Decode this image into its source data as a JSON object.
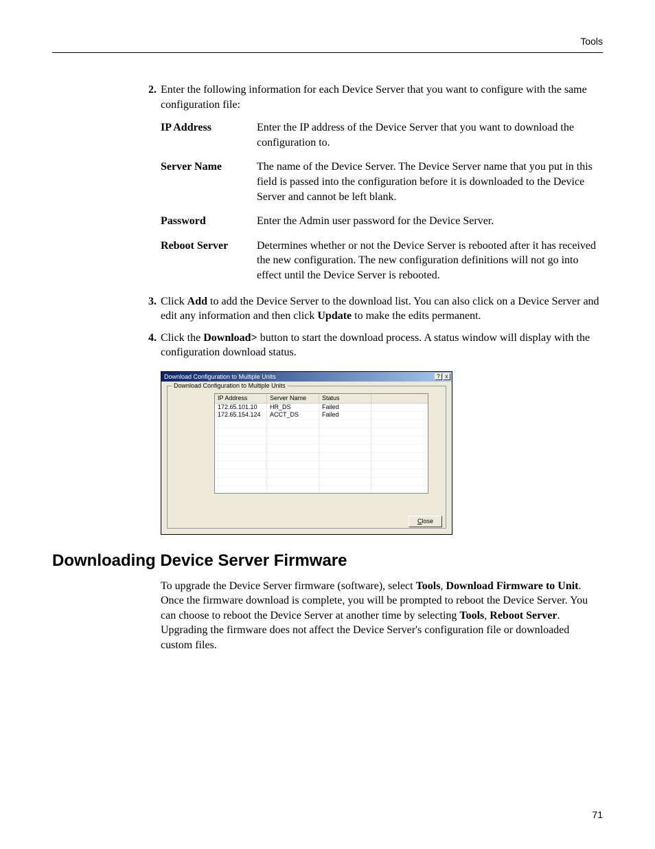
{
  "header": {
    "section": "Tools"
  },
  "pageNumber": "71",
  "list": {
    "item2": {
      "num": "2.",
      "text": "Enter the following information for each Device Server that you want to configure with the same configuration file:"
    },
    "item3": {
      "num": "3.",
      "before": "Click ",
      "b1": "Add",
      "mid": " to add the Device Server to the download list. You can also click on a Device Server and edit any information and then click ",
      "b2": "Update",
      "after": " to make the edits permanent."
    },
    "item4": {
      "num": "4.",
      "before": "Click the ",
      "b1": "Download>",
      "after": " button to start the download process. A status window will display with the configuration download status."
    }
  },
  "defs": [
    {
      "term": "IP Address",
      "desc": "Enter the IP address of the Device Server that you want to download the configuration to."
    },
    {
      "term": "Server Name",
      "desc": "The name of the Device Server. The Device Server name that you put in this field is passed into the configuration before it is downloaded to the Device Server and cannot be left blank."
    },
    {
      "term": "Password",
      "desc": "Enter the Admin user password for the Device Server."
    },
    {
      "term": "Reboot Server",
      "desc": "Determines whether or not the Device Server is rebooted after it has received the new configuration. The new configuration definitions will not go into effect until the Device Server is rebooted."
    }
  ],
  "dialog": {
    "title": "Download Configuration to Multiple Units",
    "group": "Download Configuration to Multiple Units",
    "columns": [
      "IP Address",
      "Server Name",
      "Status",
      ""
    ],
    "rows": [
      {
        "ip": "172.65.101.10",
        "name": "HR_DS",
        "status": "Failed"
      },
      {
        "ip": "172.65.154.124",
        "name": "ACCT_DS",
        "status": "Failed"
      }
    ],
    "closeU": "C",
    "closeRest": "lose",
    "help": "?",
    "x": "x"
  },
  "heading": "Downloading Device Server Firmware",
  "firmwarePara": {
    "t1": "To upgrade the Device Server firmware (software), select ",
    "b1": "Tools",
    "t2": ", ",
    "b2": "Download Firmware to Unit",
    "t3": ". Once the firmware download is complete, you will be prompted to reboot the Device Server. You can choose to reboot the Device Server at another time by selecting ",
    "b3": "Tools",
    "t4": ", ",
    "b4": "Reboot Server",
    "t5": ". Upgrading the firmware does not affect the Device Server's configuration file or downloaded custom files."
  }
}
